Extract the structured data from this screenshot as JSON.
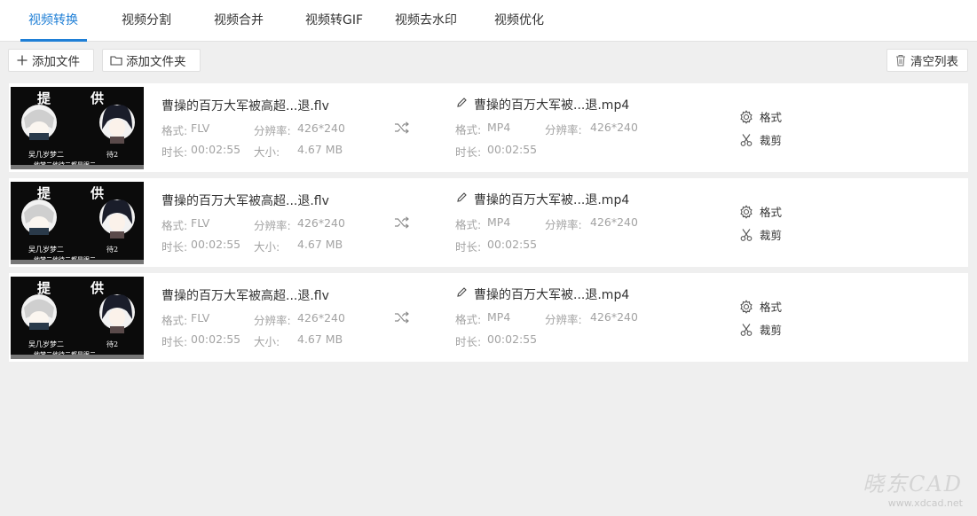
{
  "tabs": [
    {
      "label": "视频转换",
      "active": true
    },
    {
      "label": "视频分割",
      "active": false
    },
    {
      "label": "视频合并",
      "active": false
    },
    {
      "label": "视频转GIF",
      "active": false
    },
    {
      "label": "视频去水印",
      "active": false
    },
    {
      "label": "视频优化",
      "active": false
    }
  ],
  "toolbar": {
    "add_file_label": "添加文件",
    "add_folder_label": "添加文件夹",
    "clear_list_label": "清空列表"
  },
  "thumbnail": {
    "title_left": "提",
    "title_right": "供",
    "caption_left": "吴几岁梦二",
    "caption_right": "待2",
    "bottom_line": "他梦二他待二都是眼二"
  },
  "labels": {
    "format": "格式:",
    "resolution": "分辨率:",
    "duration": "时长:",
    "size": "大小:"
  },
  "actions": {
    "format_label": "格式",
    "cut_label": "裁剪"
  },
  "files": [
    {
      "source_name": "曹操的百万大军被高超...退.flv",
      "source_format": "FLV",
      "source_resolution": "426*240",
      "source_duration": "00:02:55",
      "source_size": "4.67 MB",
      "output_name": "曹操的百万大军被...退.mp4",
      "output_format": "MP4",
      "output_resolution": "426*240",
      "output_duration": "00:02:55"
    },
    {
      "source_name": "曹操的百万大军被高超...退.flv",
      "source_format": "FLV",
      "source_resolution": "426*240",
      "source_duration": "00:02:55",
      "source_size": "4.67 MB",
      "output_name": "曹操的百万大军被...退.mp4",
      "output_format": "MP4",
      "output_resolution": "426*240",
      "output_duration": "00:02:55"
    },
    {
      "source_name": "曹操的百万大军被高超...退.flv",
      "source_format": "FLV",
      "source_resolution": "426*240",
      "source_duration": "00:02:55",
      "source_size": "4.67 MB",
      "output_name": "曹操的百万大军被...退.mp4",
      "output_format": "MP4",
      "output_resolution": "426*240",
      "output_duration": "00:02:55"
    }
  ],
  "watermark": {
    "logo": "晓东CAD",
    "url": "www.xdcad.net"
  },
  "colors": {
    "accent": "#1f7fd6",
    "background": "#efefef",
    "muted_text": "#a3a3a3"
  }
}
